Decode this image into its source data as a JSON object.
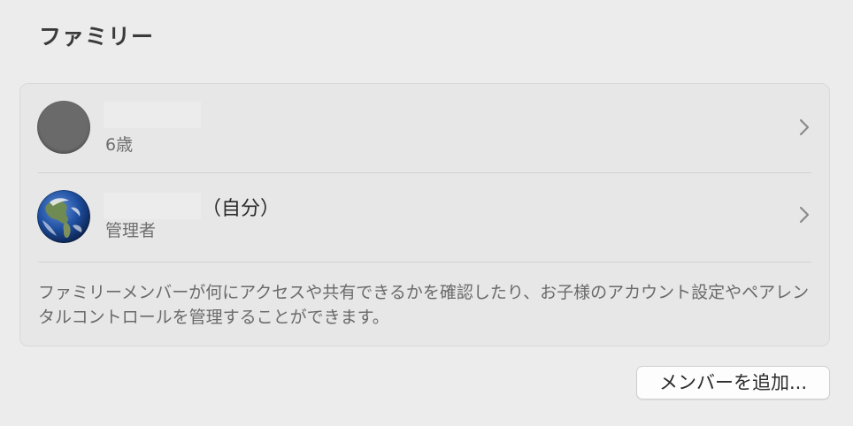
{
  "page": {
    "title": "ファミリー"
  },
  "members": [
    {
      "name": "",
      "suffix": "",
      "subtitle": "6歳",
      "avatar": "gray-placeholder-icon"
    },
    {
      "name": "",
      "suffix": "（自分）",
      "subtitle": "管理者",
      "avatar": "earth-globe-icon"
    }
  ],
  "description": "ファミリーメンバーが何にアクセスや共有できるかを確認したり、お子様のアカウント設定やペアレンタルコントロールを管理することができます。",
  "actions": {
    "add_member_label": "メンバーを追加..."
  },
  "icons": {
    "chevron": "chevron-right-icon"
  },
  "colors": {
    "background": "#ececec",
    "card": "#e7e7e7",
    "button": "#fdfdfd"
  }
}
